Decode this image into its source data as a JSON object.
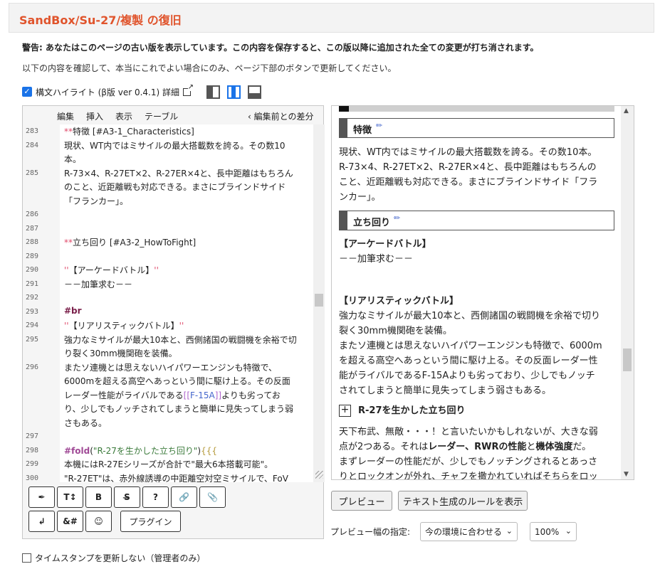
{
  "page": {
    "title": "SandBox/Su-27/複製 の復旧",
    "warning": "警告: あなたはこのページの古い版を表示しています。この内容を保存すると、この版以降に追加された全ての変更が打ち消されます。",
    "confirm_text": "以下の内容を確認して、本当にこれでよい場合にのみ、ページ下部のボタンで更新してください。"
  },
  "highlight_toggle": {
    "label": "構文ハイライト (β版 ver 0.4.1) 詳細",
    "checked": true
  },
  "editor": {
    "menu": [
      "編集",
      "挿入",
      "表示",
      "テーブル"
    ],
    "diff_label": "‹ 編集前との差分",
    "lines": [
      {
        "n": "283",
        "segments": [
          {
            "t": "**",
            "c": "mk"
          },
          {
            "t": "特徴 [#A3-1_Characteristics]",
            "c": ""
          }
        ]
      },
      {
        "n": "284",
        "segments": [
          {
            "t": "現状、WT内ではミサイルの最大搭載数を誇る。その数10",
            "c": ""
          }
        ]
      },
      {
        "n": "",
        "segments": [
          {
            "t": "本。",
            "c": ""
          }
        ]
      },
      {
        "n": "285",
        "segments": [
          {
            "t": "R-73×4、R-27ET×2、R-27ER×4と、長中距離はもちろん",
            "c": ""
          }
        ]
      },
      {
        "n": "",
        "segments": [
          {
            "t": "のこと、近距離戦も対応できる。まさにブラインドサイド",
            "c": ""
          }
        ]
      },
      {
        "n": "",
        "segments": [
          {
            "t": "「フランカー」。",
            "c": ""
          }
        ]
      },
      {
        "n": "286",
        "segments": []
      },
      {
        "n": "287",
        "segments": []
      },
      {
        "n": "288",
        "segments": [
          {
            "t": "**",
            "c": "mk"
          },
          {
            "t": "立ち回り [#A3-2_HowToFight]",
            "c": ""
          }
        ]
      },
      {
        "n": "289",
        "segments": []
      },
      {
        "n": "290",
        "segments": [
          {
            "t": "''",
            "c": "mk"
          },
          {
            "t": "【アーケードバトル】",
            "c": ""
          },
          {
            "t": "''",
            "c": "mk"
          }
        ]
      },
      {
        "n": "291",
        "segments": [
          {
            "t": "－－加筆求む－－",
            "c": ""
          }
        ]
      },
      {
        "n": "292",
        "segments": []
      },
      {
        "n": "293",
        "segments": [
          {
            "t": "#br",
            "c": "hd"
          }
        ]
      },
      {
        "n": "294",
        "segments": [
          {
            "t": "''",
            "c": "mk"
          },
          {
            "t": "【リアリスティックバトル】",
            "c": ""
          },
          {
            "t": "''",
            "c": "mk"
          }
        ]
      },
      {
        "n": "295",
        "segments": [
          {
            "t": "強力なミサイルが最大10本と、西側諸国の戦闘機を余裕で切",
            "c": ""
          }
        ]
      },
      {
        "n": "",
        "segments": [
          {
            "t": "り裂く30mm機関砲を装備。",
            "c": ""
          }
        ]
      },
      {
        "n": "296",
        "segments": [
          {
            "t": "またソ連機とは思えないハイパワーエンジンも特徴で、",
            "c": ""
          }
        ]
      },
      {
        "n": "",
        "segments": [
          {
            "t": "6000mを超える高空へあっという間に駆け上る。その反面",
            "c": ""
          }
        ]
      },
      {
        "n": "",
        "segments": [
          {
            "t": "レーダー性能がライバルである",
            "c": ""
          },
          {
            "t": "[[",
            "c": "lnkb"
          },
          {
            "t": "F-15A",
            "c": "lnkt"
          },
          {
            "t": "]]",
            "c": "lnkb"
          },
          {
            "t": "よりも劣ってお",
            "c": ""
          }
        ]
      },
      {
        "n": "",
        "segments": [
          {
            "t": "り、少しでもノッチされてしまうと簡単に見失ってしまう弱",
            "c": ""
          }
        ]
      },
      {
        "n": "",
        "segments": [
          {
            "t": "さもある。",
            "c": ""
          }
        ]
      },
      {
        "n": "297",
        "segments": []
      },
      {
        "n": "298",
        "segments": [
          {
            "t": "#fold",
            "c": "fold"
          },
          {
            "t": "(",
            "c": ""
          },
          {
            "t": "\"R-27を生かした立ち回り\"",
            "c": "str"
          },
          {
            "t": ")",
            "c": ""
          },
          {
            "t": "{{{",
            "c": "brk"
          }
        ]
      },
      {
        "n": "299",
        "segments": [
          {
            "t": "本機にはR-27Eシリーズが合計で\"最大6本搭載可能\"。",
            "c": ""
          }
        ]
      },
      {
        "n": "300",
        "segments": [
          {
            "t": "\"R-27ET\"は、赤外線誘導の中距離空対空ミサイルで、FoV",
            "c": ""
          }
        ]
      }
    ]
  },
  "toolbar": {
    "row1": [
      {
        "name": "pen-icon",
        "glyph": "✒"
      },
      {
        "name": "text-size-icon",
        "glyph": "T↕"
      },
      {
        "name": "bold-icon",
        "glyph": "B"
      },
      {
        "name": "strikethrough-icon",
        "glyph": "S̶"
      },
      {
        "name": "help-icon",
        "glyph": "?"
      },
      {
        "name": "link-icon",
        "glyph": "🔗"
      },
      {
        "name": "attach-icon",
        "glyph": "📎"
      }
    ],
    "row2": [
      {
        "name": "newline-icon",
        "glyph": "↲"
      },
      {
        "name": "char-ref-icon",
        "glyph": "&#"
      },
      {
        "name": "emoji-icon",
        "glyph": "☺"
      }
    ],
    "plugin_label": "プラグイン"
  },
  "preview": {
    "heading1": "特徴",
    "para1": [
      "現状、WT内ではミサイルの最大搭載数を誇る。その数10本。",
      "R-73×4、R-27ET×2、R-27ER×4と、長中距離はもちろんの",
      "こと、近距離戦も対応できる。まさにブラインドサイド「フラ",
      "ンカー」。"
    ],
    "heading2": "立ち回り",
    "arcade_title": "【アーケードバトル】",
    "arcade_text": "－－加筆求む－－",
    "realistic_title": "【リアリスティックバトル】",
    "realistic_text": [
      "強力なミサイルが最大10本と、西側諸国の戦闘機を余裕で切り",
      "裂く30mm機関砲を装備。",
      "またソ連機とは思えないハイパワーエンジンも特徴で、6000m",
      "を超える高空へあっという間に駆け上る。その反面レーダー性",
      "能がライバルであるF-15Aよりも劣っており、少しでもノッチ",
      "されてしまうと簡単に見失ってしまう弱さもある。"
    ],
    "fold_title": "R-27を生かした立ち回り",
    "para_last_1": "天下布武、無敵・・・！と言いたいかもしれないが、大きな弱",
    "para_last_2_pre": "点が2つある。それは",
    "para_last_2_b1": "レーダー、RWRの性能",
    "para_last_2_mid": "と",
    "para_last_2_b2": "機体強度",
    "para_last_2_post": "だ。",
    "para_last_3": "まずレーダーの性能だが、少しでもノッチングされるとあっさ",
    "para_last_4": "りとロックオンが外れ、チャフを撒かれていればそちらをロッ"
  },
  "buttons": {
    "preview": "プレビュー",
    "show_rules": "テキスト生成のルールを表示"
  },
  "preview_width": {
    "label": "プレビュー幅の指定:",
    "mode_value": "今の環境に合わせる",
    "zoom_value": "100%"
  },
  "timestamp_option": {
    "label": "タイムスタンプを更新しない（管理者のみ）",
    "checked": false
  }
}
